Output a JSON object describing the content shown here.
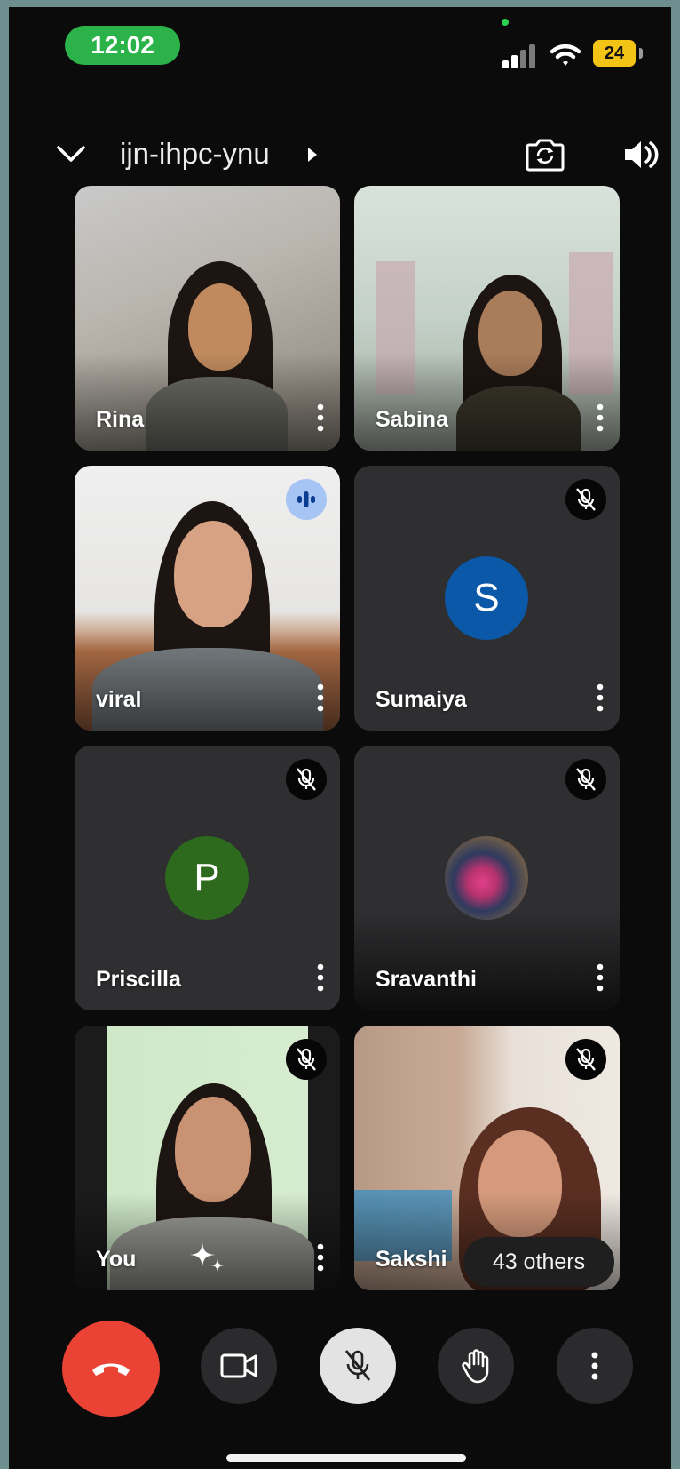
{
  "status_bar": {
    "time": "12:02",
    "battery": "24"
  },
  "header": {
    "meeting_code": "ijn-ihpc-ynu"
  },
  "tiles": [
    {
      "name": "Rina",
      "muted": false
    },
    {
      "name": "Sabina",
      "muted": false
    },
    {
      "name": "viral",
      "speaking": true
    },
    {
      "name": "Sumaiya",
      "muted": true,
      "avatar_letter": "S",
      "avatar_color": "#0b57a8"
    },
    {
      "name": "Priscilla",
      "muted": true,
      "avatar_letter": "P",
      "avatar_color": "#2d6a1e"
    },
    {
      "name": "Sravanthi",
      "muted": true
    },
    {
      "name": "You",
      "muted": true
    },
    {
      "name": "Sakshi",
      "muted": true
    }
  ],
  "others": "43 others",
  "colors": {
    "end_call": "#ea4335",
    "status_green": "#2bb34a",
    "battery_yellow": "#f3c316",
    "speaking_blue": "#a6c4f4"
  },
  "controls": [
    "end-call",
    "camera",
    "microphone",
    "raise-hand",
    "more-options"
  ]
}
